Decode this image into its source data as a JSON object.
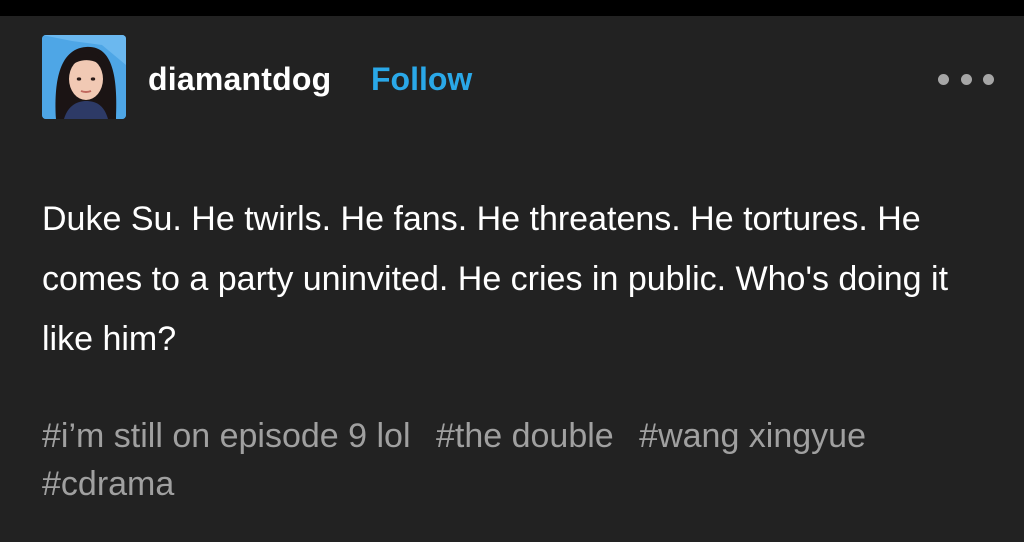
{
  "post": {
    "username": "diamantdog",
    "follow_label": "Follow",
    "more_icon": "more-horizontal-icon",
    "body": "Duke Su. He twirls. He fans. He threatens. He tortures. He comes to a party uninvited. He cries in public. Who's doing it like him?",
    "tags": [
      "#i’m still on episode 9 lol",
      "#the double",
      "#wang xingyue",
      "#cdrama"
    ]
  },
  "colors": {
    "background": "#222222",
    "text": "#ffffff",
    "follow": "#2aa8e8",
    "tags": "#a0a0a0"
  }
}
